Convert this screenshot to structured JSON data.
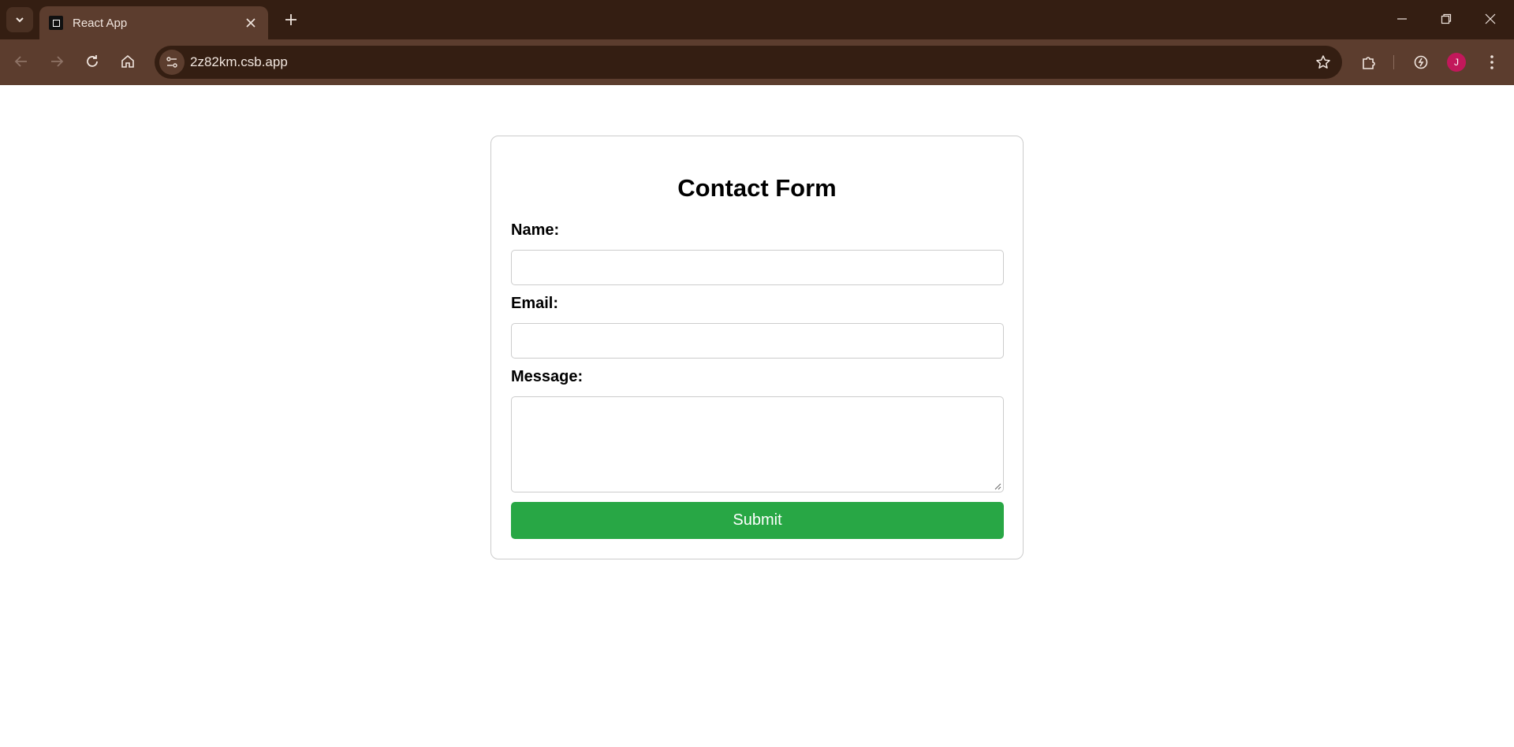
{
  "browser": {
    "tab_title": "React App",
    "url": "2z82km.csb.app",
    "profile_initial": "J"
  },
  "form": {
    "title": "Contact Form",
    "name_label": "Name:",
    "name_value": "",
    "email_label": "Email:",
    "email_value": "",
    "message_label": "Message:",
    "message_value": "",
    "submit_label": "Submit"
  },
  "colors": {
    "chrome_dark": "#341e12",
    "chrome_light": "#5c3d2e",
    "submit_green": "#28a745",
    "avatar": "#c2185b"
  }
}
